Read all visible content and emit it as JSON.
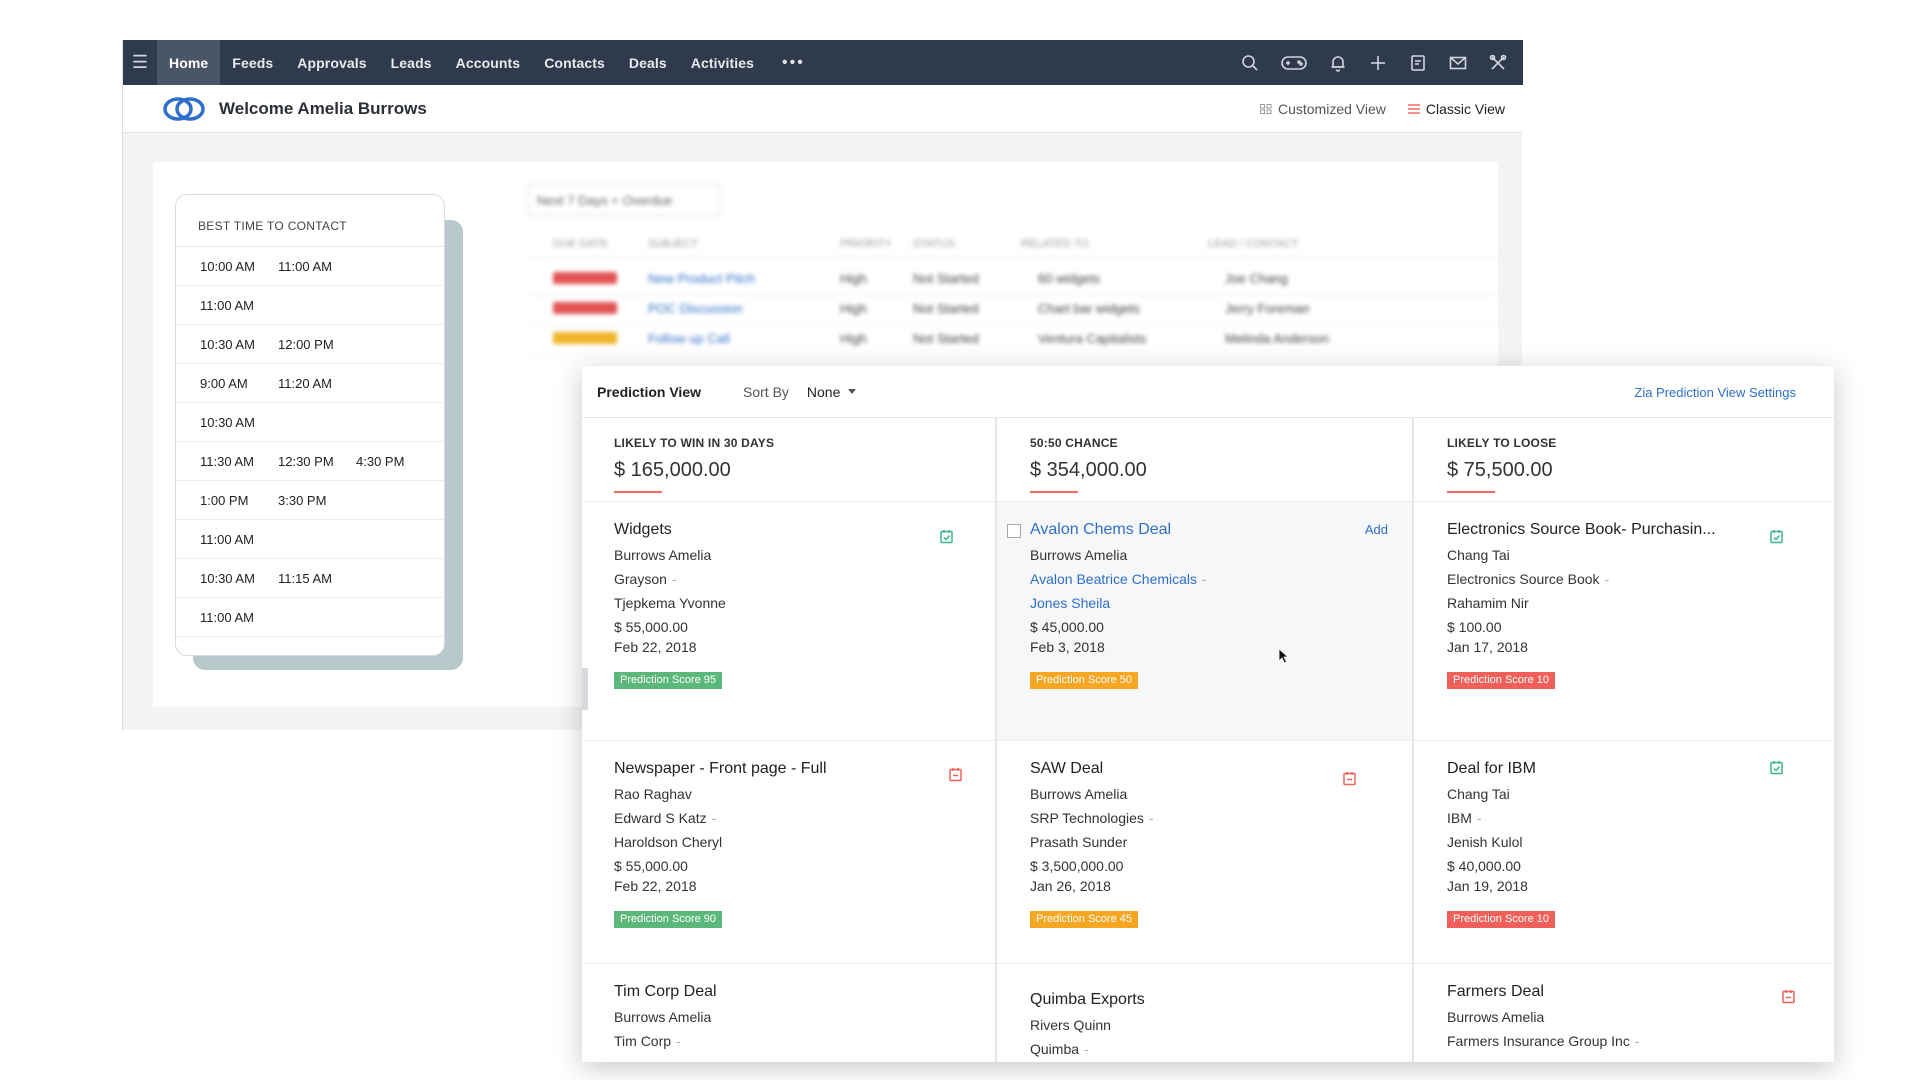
{
  "nav": {
    "items": [
      "Home",
      "Feeds",
      "Approvals",
      "Leads",
      "Accounts",
      "Contacts",
      "Deals",
      "Activities"
    ],
    "more": "•••"
  },
  "welcome": {
    "text": "Welcome Amelia Burrows"
  },
  "views": {
    "customized": "Customized View",
    "classic": "Classic View"
  },
  "best_time": {
    "title": "BEST TIME TO CONTACT",
    "rows": [
      [
        "10:00 AM",
        "11:00 AM",
        ""
      ],
      [
        "11:00 AM",
        "",
        ""
      ],
      [
        "10:30 AM",
        "12:00 PM",
        ""
      ],
      [
        "9:00 AM",
        "11:20 AM",
        ""
      ],
      [
        "10:30 AM",
        "",
        ""
      ],
      [
        "11:30 AM",
        "12:30 PM",
        "4:30 PM"
      ],
      [
        "1:00 PM",
        "3:30 PM",
        ""
      ],
      [
        "11:00 AM",
        "",
        ""
      ],
      [
        "10:30 AM",
        "11:15 AM",
        ""
      ],
      [
        "11:00 AM",
        "",
        ""
      ]
    ]
  },
  "activities": {
    "filter": "Next 7 Days + Overdue",
    "headers": [
      "DUE DATE",
      "SUBJECT",
      "PRIORITY",
      "STATUS",
      "RELATED TO",
      "LEAD / CONTACT"
    ],
    "rows": [
      {
        "subject": "New Product Pitch",
        "priority": "High",
        "status": "Not Started",
        "related": "60 widgets",
        "contact": "Joe Chang",
        "tag": "#e25353"
      },
      {
        "subject": "POC Discussion",
        "priority": "High",
        "status": "Not Started",
        "related": "Chart bar widgets",
        "contact": "Jerry Foreman",
        "tag": "#e25353"
      },
      {
        "subject": "Follow up Call",
        "priority": "High",
        "status": "Not Started",
        "related": "Ventura Capitalists",
        "contact": "Melinda Anderson",
        "tag": "#f0b429"
      }
    ]
  },
  "prediction": {
    "title": "Prediction View",
    "sort_by_label": "Sort By",
    "sort_by_value": "None",
    "settings_link": "Zia Prediction View Settings",
    "columns": [
      {
        "label": "LIKELY TO WIN IN 30 DAYS",
        "amount": "$ 165,000.00",
        "deals": [
          {
            "name": "Widgets",
            "owner": "Burrows Amelia",
            "account": "Grayson",
            "contact": "Tjepkema Yvonne",
            "amount": "$ 55,000.00",
            "date": "Feb 22, 2018",
            "score": "Prediction Score 95"
          },
          {
            "name": "Newspaper - Front page - Full",
            "owner": "Rao Raghav",
            "account": "Edward S Katz",
            "contact": "Haroldson Cheryl",
            "amount": "$ 55,000.00",
            "date": "Feb 22, 2018",
            "score": "Prediction Score 90"
          },
          {
            "name": "Tim Corp Deal",
            "owner": "Burrows Amelia",
            "account": "Tim Corp"
          }
        ]
      },
      {
        "label": "50:50 CHANCE",
        "amount": "$ 354,000.00",
        "add_label": "Add",
        "deals": [
          {
            "name": "Avalon Chems Deal",
            "owner": "Burrows Amelia",
            "account": "Avalon Beatrice Chemicals",
            "contact": "Jones Sheila",
            "amount": "$ 45,000.00",
            "date": "Feb 3, 2018",
            "score": "Prediction Score 50"
          },
          {
            "name": "SAW Deal",
            "owner": "Burrows Amelia",
            "account": "SRP Technologies",
            "contact": "Prasath Sunder",
            "amount": "$ 3,500,000.00",
            "date": "Jan 26, 2018",
            "score": "Prediction Score 45"
          },
          {
            "name": "Quimba Exports",
            "owner": "Rivers Quinn",
            "account": "Quimba"
          }
        ]
      },
      {
        "label": "LIKELY TO LOOSE",
        "amount": "$ 75,500.00",
        "deals": [
          {
            "name": "Electronics Source Book- Purchasin...",
            "owner": "Chang Tai",
            "account": "Electronics Source Book",
            "contact": "Rahamim Nir",
            "amount": "$ 100.00",
            "date": "Jan 17, 2018",
            "score": "Prediction Score 10"
          },
          {
            "name": "Deal for IBM",
            "owner": "Chang Tai",
            "account": "IBM",
            "contact": "Jenish Kulol",
            "amount": "$ 40,000.00",
            "date": "Jan 19, 2018",
            "score": "Prediction Score 10"
          },
          {
            "name": "Farmers Deal",
            "owner": "Burrows Amelia",
            "account": "Farmers Insurance Group Inc"
          }
        ]
      }
    ]
  },
  "colors": {
    "nav_bg": "#2f3b4c",
    "link": "#2f6fc9",
    "score_green": "#5cb87a",
    "score_orange": "#f5a623",
    "score_red": "#f0605a",
    "underline": "#f26a5f"
  }
}
